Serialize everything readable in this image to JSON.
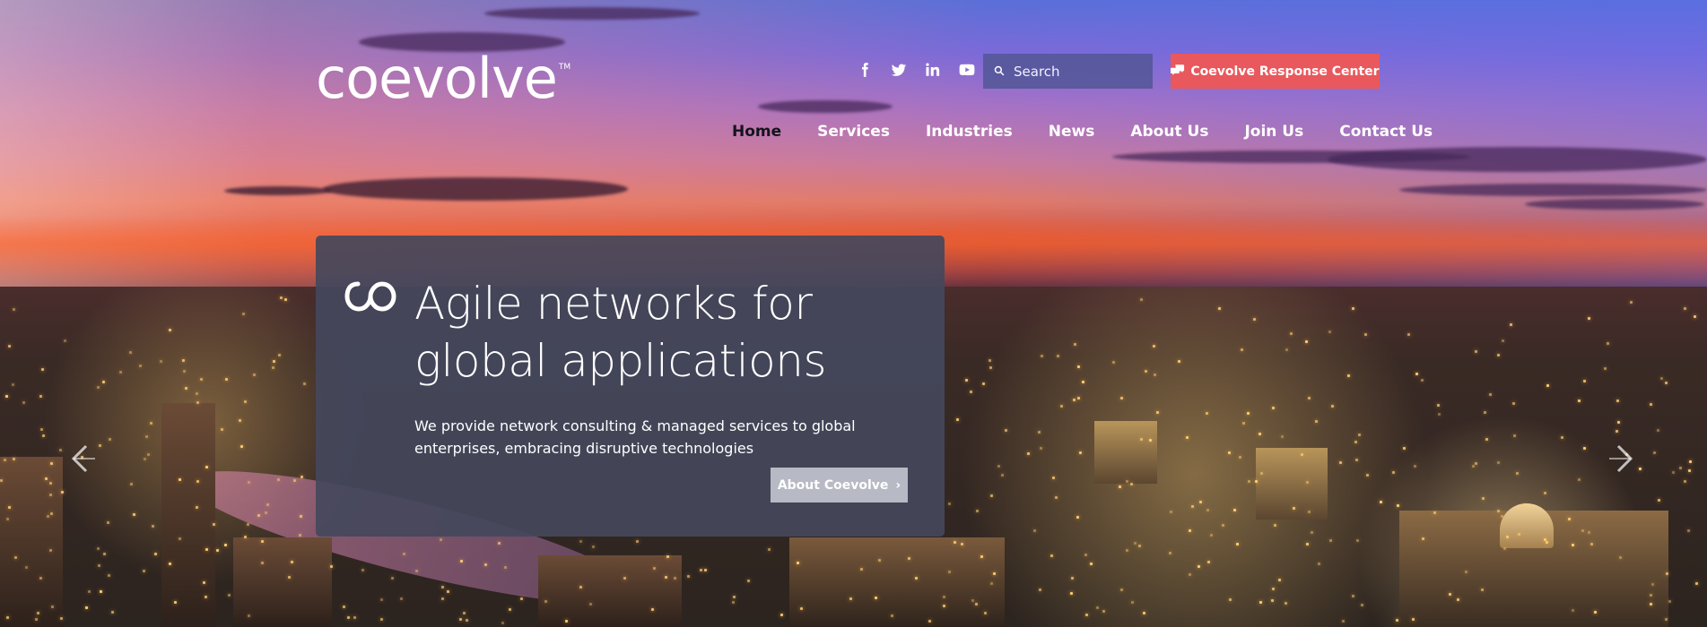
{
  "brand": {
    "logo_text": "coevolve",
    "trademark": "TM"
  },
  "social": [
    {
      "icon": "facebook-icon"
    },
    {
      "icon": "twitter-icon"
    },
    {
      "icon": "linkedin-icon"
    },
    {
      "icon": "youtube-icon"
    }
  ],
  "search": {
    "placeholder": "Search",
    "value": ""
  },
  "response_center": {
    "label": "Coevolve Response Center",
    "color": "#e8585c"
  },
  "nav": {
    "items": [
      {
        "label": "Home",
        "active": true
      },
      {
        "label": "Services",
        "active": false
      },
      {
        "label": "Industries",
        "active": false
      },
      {
        "label": "News",
        "active": false
      },
      {
        "label": "About Us",
        "active": false
      },
      {
        "label": "Join Us",
        "active": false
      },
      {
        "label": "Contact Us",
        "active": false
      }
    ]
  },
  "hero": {
    "headline": "Agile networks for global applications",
    "subtext": "We provide network consulting & managed services to global enterprises, embracing disruptive technologies",
    "cta_label": "About Coevolve",
    "cta_chevron": "›"
  }
}
